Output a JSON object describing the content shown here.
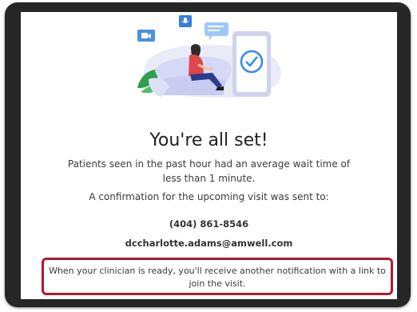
{
  "confirmation": {
    "title": "You're all set!",
    "wait_message": "Patients seen in the past hour had an average wait time of less than 1 minute.",
    "confirmation_message": "A confirmation for the upcoming visit was sent to:",
    "phone": "(404) 861-8546",
    "email": "dccharlotte.adams@amwell.com",
    "notification_message": "When your clinician is ready, you'll receive another notification with a link to join the visit."
  },
  "icons": [
    "video-camera-icon",
    "microphone-icon",
    "chat-bubble-icon",
    "check-circle-icon",
    "leaf-icon"
  ],
  "colors": {
    "highlight_border": "#b0192f",
    "accent_blue": "#3a86f0",
    "device_frame": "#262626"
  }
}
